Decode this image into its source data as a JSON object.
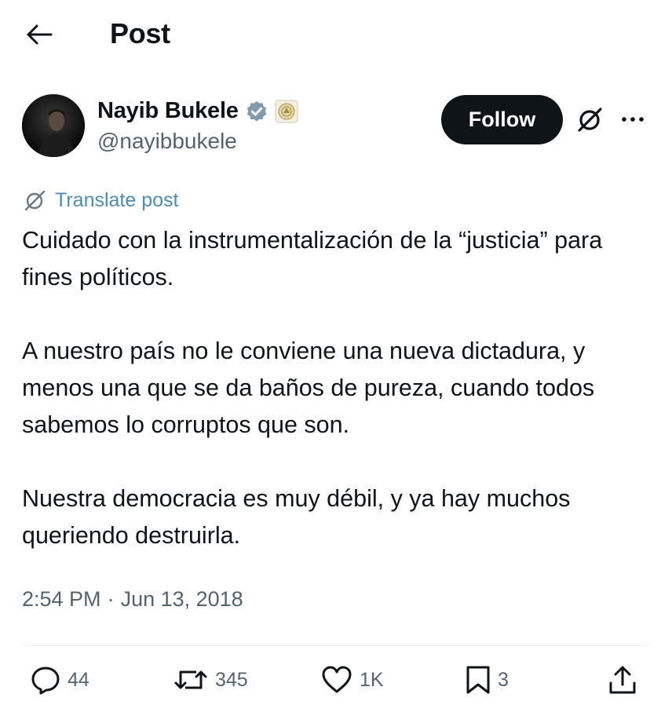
{
  "header": {
    "title": "Post",
    "back_icon": "arrow-left-icon"
  },
  "author": {
    "name": "Nayib Bukele",
    "handle": "@nayibbukele",
    "verified_icon": "verified-badge-icon",
    "affiliate_badge": "government-seal-badge"
  },
  "follow_button": {
    "label": "Follow"
  },
  "translate": {
    "label": "Translate post",
    "icon": "grok-icon"
  },
  "post": {
    "paragraphs": [
      "Cuidado con la instrumentalización de la “justicia” para fines políticos.",
      "A nuestro país no le conviene una nueva dictadura, y menos una que se da baños de pureza, cuando todos sabemos lo corruptos que son.",
      "Nuestra democracia es muy débil, y ya hay muchos queriendo destruirla."
    ]
  },
  "timestamp": {
    "time": "2:54 PM",
    "separator": "·",
    "date": "Jun 13, 2018"
  },
  "actions": {
    "replies": "44",
    "reposts": "345",
    "likes": "1K",
    "bookmarks": "3"
  },
  "colors": {
    "text": "#0f1419",
    "secondary": "#536471",
    "link": "#4e8cb1",
    "verified": "#829aab",
    "follow_bg": "#0f1419"
  }
}
